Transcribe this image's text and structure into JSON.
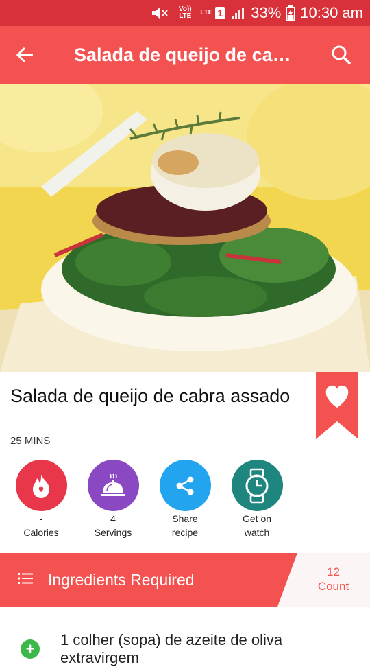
{
  "status_bar": {
    "network": "Vo)) LTE",
    "lte": "LTE",
    "sim": "1",
    "battery": "33%",
    "time": "10:30 am"
  },
  "app_bar": {
    "title": "Salada de queijo de ca…",
    "back_icon": "arrow-back-icon",
    "search_icon": "search-icon"
  },
  "recipe": {
    "title": "Salada de queijo de cabra assado",
    "time": "25 MINS"
  },
  "actions": [
    {
      "icon": "flame-icon",
      "value": "-",
      "label": "Calories",
      "color": "#e8374a"
    },
    {
      "icon": "cloche-icon",
      "value": "4",
      "label": "Servings",
      "color": "#8a49c3"
    },
    {
      "icon": "share-icon",
      "value": "Share",
      "label": "recipe",
      "color": "#23a4ee"
    },
    {
      "icon": "watch-icon",
      "value": "Get on",
      "label": "watch",
      "color": "#1f857f"
    }
  ],
  "ingredients_header": {
    "label": "Ingredients Required",
    "count_value": "12",
    "count_label": "Count"
  },
  "ingredients": [
    {
      "text": "1 colher (sopa) de azeite de oliva extravirgem"
    }
  ],
  "colors": {
    "status": "#d8313a",
    "primary": "#f45151",
    "add": "#3cb84a"
  }
}
